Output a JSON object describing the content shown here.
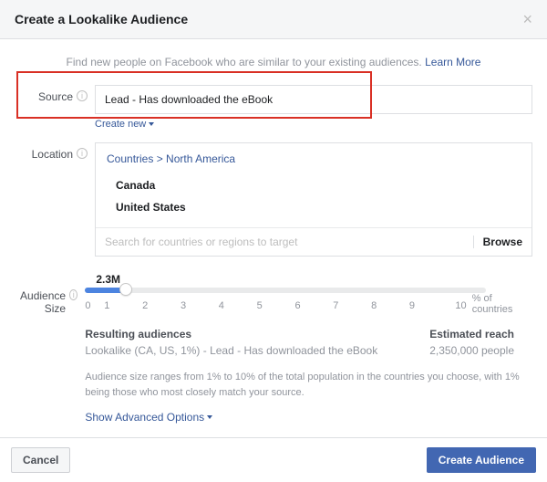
{
  "header": {
    "title": "Create a Lookalike Audience"
  },
  "intro": {
    "text": "Find new people on Facebook who are similar to your existing audiences. ",
    "learn_more": "Learn More"
  },
  "source": {
    "label": "Source",
    "value": "Lead - Has downloaded the eBook",
    "create_new": "Create new"
  },
  "location": {
    "label": "Location",
    "breadcrumb_root": "Countries",
    "breadcrumb_sep": " > ",
    "breadcrumb_leaf": "North America",
    "items": [
      "Canada",
      "United States"
    ],
    "search_placeholder": "Search for countries or regions to target",
    "browse": "Browse"
  },
  "size": {
    "label": "Audience Size",
    "value_display": "2.3M",
    "ticks": [
      "0",
      "1",
      "2",
      "3",
      "4",
      "5",
      "6",
      "7",
      "8",
      "9",
      "10"
    ],
    "ticks_suffix": "% of countries"
  },
  "results": {
    "heading": "Resulting audiences",
    "name": "Lookalike (CA, US, 1%) - Lead - Has downloaded the eBook",
    "reach_heading": "Estimated reach",
    "reach_value": "2,350,000 people"
  },
  "disclaimer": "Audience size ranges from 1% to 10% of the total population in the countries you choose, with 1% being those who most closely match your source.",
  "advanced": "Show Advanced Options",
  "footer": {
    "cancel": "Cancel",
    "create": "Create Audience"
  }
}
